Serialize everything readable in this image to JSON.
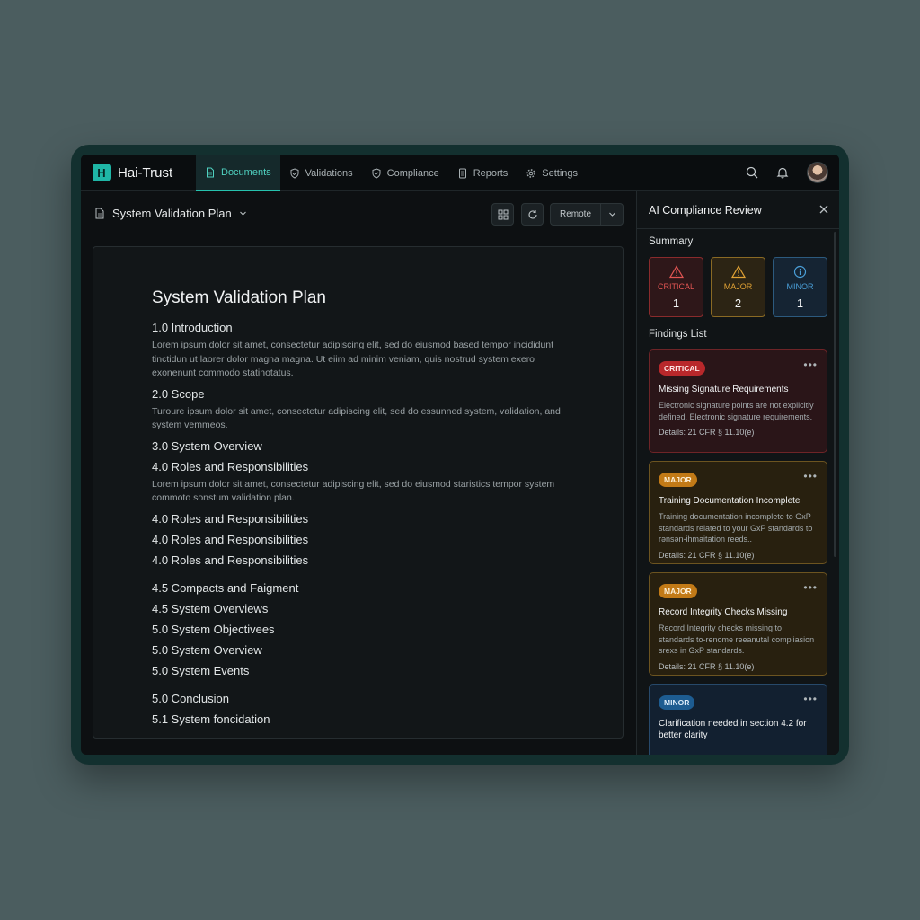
{
  "brand": {
    "logo_letter": "H",
    "name": "Hai-Trust",
    "accent": "#26c2ae"
  },
  "nav": {
    "tabs": [
      {
        "label": "Documents",
        "icon": "document-icon",
        "active": true
      },
      {
        "label": "Validations",
        "icon": "shield-check-icon",
        "active": false
      },
      {
        "label": "Compliance",
        "icon": "shield-icon",
        "active": false
      },
      {
        "label": "Reports",
        "icon": "report-icon",
        "active": false
      },
      {
        "label": "Settings",
        "icon": "gear-icon",
        "active": false
      }
    ]
  },
  "doc_header": {
    "title": "System Validation Plan",
    "remote_label": "Remote"
  },
  "document": {
    "title": "System Validation Plan",
    "sections": [
      {
        "heading": "1.0 Introduction",
        "body": "Lorem ipsum dolor sit amet, consectetur adipiscing elit, sed do eiusmod based tempor incididunt tinctidun ut laorer dolor magna magna. Ut eiim ad minim veniam, quis nostrud system exero exonenunt commodo statinotatus."
      },
      {
        "heading": "2.0 Scope",
        "body": "Turoure ipsum dolor sit amet, consectetur adipiscing elit, sed do essunned system, validation, and system vemmeos."
      },
      {
        "heading": "3.0 System Overview",
        "body": ""
      },
      {
        "heading": "4.0 Roles and Responsibilities",
        "body": "Lorem ipsum dolor sit amet, consectetur adipiscing elit, sed do eiusmod staristics tempor system commoto sonstum validation plan."
      },
      {
        "heading": "4.0 Roles and Responsibilities",
        "body": ""
      },
      {
        "heading": "4.0 Roles and Responsibilities",
        "body": ""
      },
      {
        "heading": "4.0 Roles and Responsibilities",
        "body": "",
        "gap_after": true
      },
      {
        "heading": "4.5 Compacts and Faigment",
        "body": ""
      },
      {
        "heading": "4.5 System Overviews",
        "body": ""
      },
      {
        "heading": "5.0 System Objectivees",
        "body": ""
      },
      {
        "heading": "5.0 System Overview",
        "body": ""
      },
      {
        "heading": "5.0 System Events",
        "body": "",
        "gap_after": true
      },
      {
        "heading": "5.0 Conclusion",
        "body": ""
      },
      {
        "heading": "5.1 System foncidation",
        "body": ""
      }
    ]
  },
  "review": {
    "title": "AI Compliance Review",
    "summary_label": "Summary",
    "summary": [
      {
        "label": "CRITICAL",
        "count": "1",
        "color": "#e25553"
      },
      {
        "label": "MAJOR",
        "count": "2",
        "color": "#e1a234"
      },
      {
        "label": "MINOR",
        "count": "1",
        "color": "#4a9fd8"
      }
    ],
    "findings_label": "Findings List",
    "findings": [
      {
        "severity": "CRITICAL",
        "title": "Missing Signature Requirements",
        "desc": "Electronic signature points are not explicitly defined. Electronic signature requirements.",
        "details": "Details: 21 CFR § 11.10(e)"
      },
      {
        "severity": "MAJOR",
        "title": "Training Documentation Incomplete",
        "desc": "Training documentation incomplete to GxP standards related to your GxP standards to rənsən-ihmaitation reeds..",
        "details": "Details: 21 CFR § 11.10(e)"
      },
      {
        "severity": "MAJOR",
        "title": "Record Integrity Checks Missing",
        "desc": "Record Integrity checks missing to standards to-renome reeanutal compliasion srexs in GxP standards.",
        "details": "Details: 21 CFR § 11.10(e)"
      },
      {
        "severity": "MINOR",
        "title": "Clarification needed in section 4.2 for better clarity",
        "desc": "",
        "details": ""
      }
    ]
  }
}
